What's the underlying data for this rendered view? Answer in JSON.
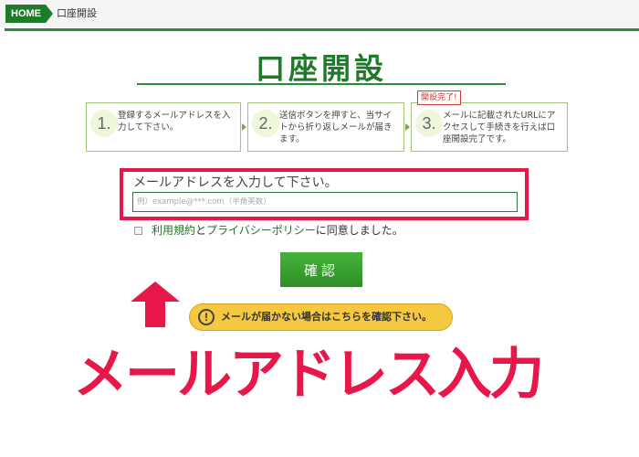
{
  "breadcrumb": {
    "home": "HOME",
    "current": "口座開設"
  },
  "page": {
    "title": "口座開設"
  },
  "steps": [
    {
      "number": "1.",
      "text": "登録するメールアドレスを入力して下さい。"
    },
    {
      "number": "2.",
      "text": "送信ボタンを押すと、当サイトから折り返しメールが届きます。"
    },
    {
      "number": "3.",
      "text": "メールに記載されたURLにアクセスして手続きを行えば口座開設完了です。",
      "badge": "開設完了!"
    }
  ],
  "email": {
    "label": "メールアドレスを入力して下さい。",
    "placeholder": "例）example@***.com（半角英数）"
  },
  "agreement": {
    "terms_link": "利用規約",
    "and": "と",
    "privacy_link": "プライバシーポリシー",
    "suffix": "に同意しました。"
  },
  "confirm": {
    "label": "確認"
  },
  "notice": {
    "icon": "!",
    "text": "メールが届かない場合はこちらを確認下さい。"
  },
  "annotation": {
    "caption": "メールアドレス入力"
  },
  "colors": {
    "brand_green": "#1f7a2a",
    "highlight_red": "#e8174a",
    "notice_yellow": "#f5c842"
  }
}
